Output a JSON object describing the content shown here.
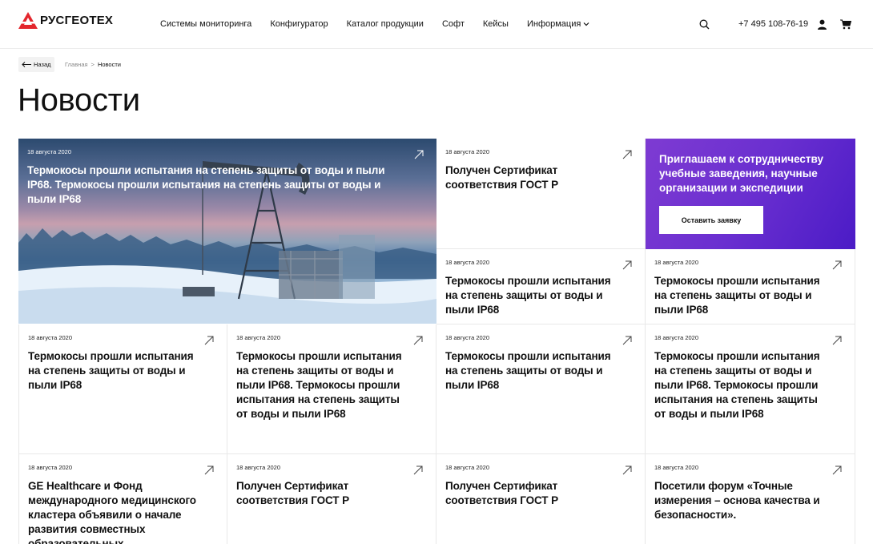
{
  "header": {
    "logo_text": "РУСГЕОТЕХ",
    "nav": [
      "Системы мониторинга",
      "Конфигуратор",
      "Каталог продукции",
      "Софт",
      "Кейсы",
      "Информация"
    ],
    "phone": "+7 495 108-76-19",
    "brand_color": "#e3262d"
  },
  "breadcrumbs": {
    "back_label": "Назад",
    "home": "Главная",
    "separator": ">",
    "current": "Новости"
  },
  "page_title": "Новости",
  "cards": [
    {
      "date": "18 августа 2020",
      "title": "Термокосы прошли испытания на степень защиты от воды и пыли IP68. Термокосы прошли испытания на степень защиты от воды и пыли IP68"
    },
    {
      "date": "18 августа 2020",
      "title": "Получен Сертификат соответствия ГОСТ Р"
    },
    {
      "date": "18 августа 2020",
      "title": "Термокосы прошли испытания на степень защиты от воды и пыли IP68"
    },
    {
      "date": "18 августа 2020",
      "title": "Термокосы прошли испытания на степень защиты от воды и пыли IP68"
    },
    {
      "date": "18 августа 2020",
      "title": "Термокосы прошли испытания на степень защиты от воды и пыли IP68"
    },
    {
      "date": "18 августа 2020",
      "title": "Термокосы прошли испытания на степень защиты от воды и пыли IP68. Термокосы прошли испытания на степень защиты от воды и пыли IP68"
    },
    {
      "date": "18 августа 2020",
      "title": "Термокосы прошли испытания на степень защиты от воды и пыли IP68"
    },
    {
      "date": "18 августа 2020",
      "title": "Термокосы прошли испытания на степень защиты от воды и пыли IP68. Термокосы прошли испытания на степень защиты от воды и пыли IP68"
    },
    {
      "date": "18 августа 2020",
      "title": "GE Healthcare и Фонд международного медицинского кластера объявили о начале развития совместных образовательных"
    },
    {
      "date": "18 августа 2020",
      "title": "Получен Сертификат соответствия ГОСТ Р"
    },
    {
      "date": "18 августа 2020",
      "title": "Получен Сертификат соответствия ГОСТ Р"
    },
    {
      "date": "18 августа 2020",
      "title": "Посетили форум «Точные измерения – основа качества и безопасности»."
    }
  ],
  "promo": {
    "title": "Приглашаем к сотрудничеству учебные заведения, научные организации и экспедиции",
    "button": "Оставить заявку"
  }
}
